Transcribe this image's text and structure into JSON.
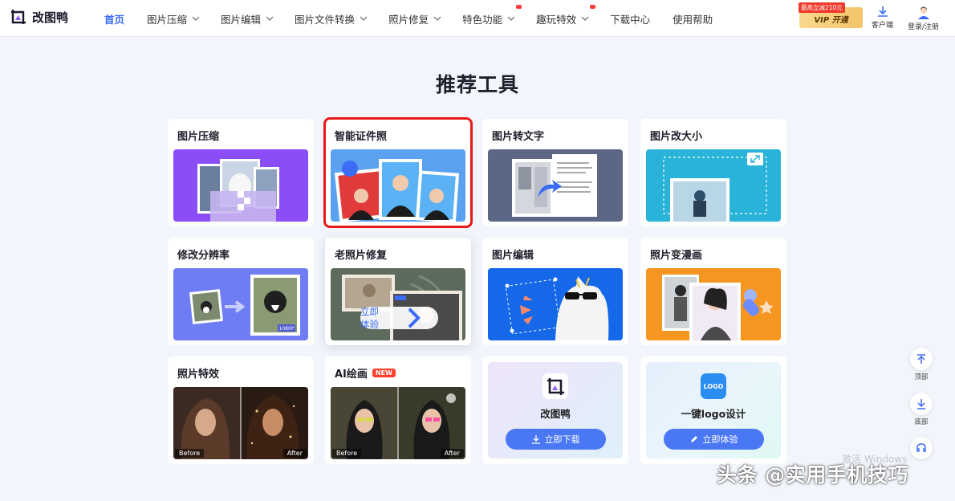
{
  "brand": {
    "name": "改图鸭"
  },
  "nav": {
    "items": [
      {
        "label": "首页",
        "active": true,
        "dropdown": false,
        "hot": false
      },
      {
        "label": "图片压缩",
        "active": false,
        "dropdown": true,
        "hot": false
      },
      {
        "label": "图片编辑",
        "active": false,
        "dropdown": true,
        "hot": false
      },
      {
        "label": "图片文件转换",
        "active": false,
        "dropdown": true,
        "hot": false
      },
      {
        "label": "照片修复",
        "active": false,
        "dropdown": true,
        "hot": false
      },
      {
        "label": "特色功能",
        "active": false,
        "dropdown": true,
        "hot": true
      },
      {
        "label": "趣玩特效",
        "active": false,
        "dropdown": true,
        "hot": true
      },
      {
        "label": "下载中心",
        "active": false,
        "dropdown": false,
        "hot": false
      },
      {
        "label": "使用帮助",
        "active": false,
        "dropdown": false,
        "hot": false
      }
    ],
    "vip_promo": "最高立减210元",
    "vip_label": "VIP 开通",
    "client_label": "客户端",
    "login_label": "登录/注册"
  },
  "page_title": "推荐工具",
  "tools": [
    {
      "title": "图片压缩",
      "icon": "compress"
    },
    {
      "title": "智能证件照",
      "icon": "id-photo",
      "selected": true
    },
    {
      "title": "图片转文字",
      "icon": "ocr"
    },
    {
      "title": "图片改大小",
      "icon": "resize"
    },
    {
      "title": "修改分辨率",
      "icon": "resolution",
      "res_tag": "1080P"
    },
    {
      "title": "老照片修复",
      "icon": "restore",
      "hovered": true,
      "hover_button": "立即体验"
    },
    {
      "title": "图片编辑",
      "icon": "edit"
    },
    {
      "title": "照片变漫画",
      "icon": "cartoon"
    },
    {
      "title": "照片特效",
      "icon": "effects",
      "before": "Before",
      "after": "After"
    },
    {
      "title": "AI绘画",
      "icon": "ai-paint",
      "badge": "NEW",
      "before": "Before",
      "after": "After"
    }
  ],
  "apps": [
    {
      "name": "改图鸭",
      "button": "立即下载",
      "icon": "duck-logo-icon",
      "button_icon": "download-icon"
    },
    {
      "name": "一键logo设计",
      "button": "立即体验",
      "icon": "logo-design-icon",
      "button_icon": "pen-icon",
      "icon_text": "LOGO"
    }
  ],
  "rail": {
    "top_label": "顶部",
    "bottom_label": "底部"
  },
  "watermarks": {
    "windows": "激活 Windows",
    "toutiao": "头条 @实用手机技巧"
  },
  "colors": {
    "accent": "#3b6cf6",
    "selection": "#e81919"
  }
}
